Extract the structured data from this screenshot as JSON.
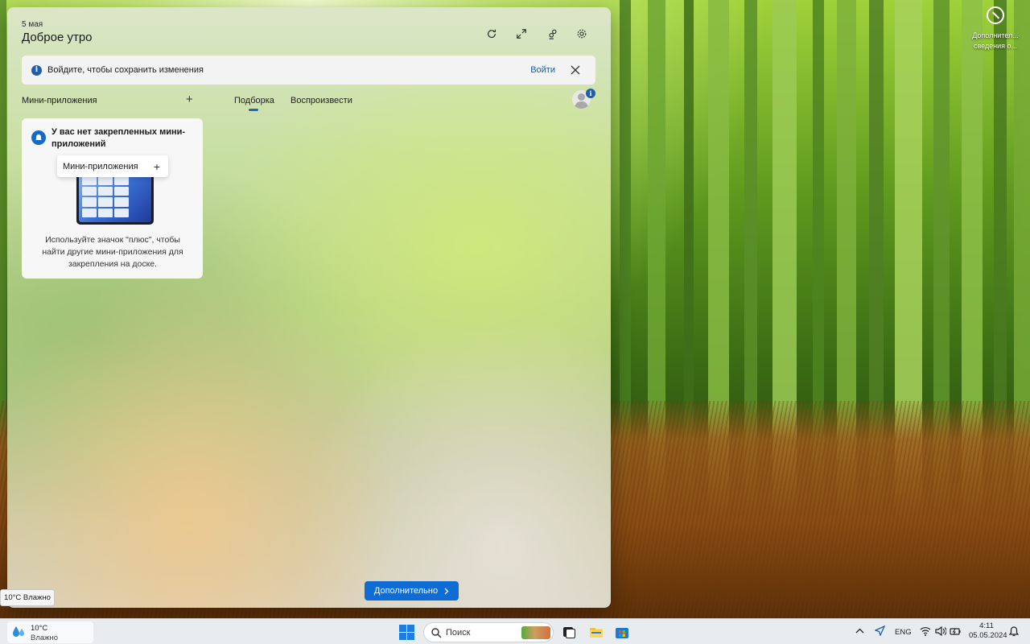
{
  "board": {
    "date": "5 мая",
    "greeting": "Доброе утро",
    "banner": {
      "message": "Войдите, чтобы сохранить изменения",
      "signin_link": "Войти"
    },
    "widgets_section_title": "Мини-приложения",
    "tabs": [
      {
        "label": "Подборка",
        "active": true
      },
      {
        "label": "Воспроизвести",
        "active": false
      }
    ],
    "empty_card": {
      "title": "У вас нет закрепленных мини-приложений",
      "pill_label": "Мини-приложения",
      "description": "Используйте значок \"плюс\", чтобы найти другие мини-приложения для закрепления на доске."
    },
    "more_button": "Дополнительно",
    "accent_color": "#0f6cd4"
  },
  "weather_tooltip": "10°C Влажно",
  "desktop_icon": {
    "line1": "Дополнител...",
    "line2": "сведения о..."
  },
  "taskbar": {
    "weather": {
      "temp": "10°C",
      "condition": "Влажно"
    },
    "search_placeholder": "Поиск",
    "tray": {
      "language": "ENG"
    },
    "clock": {
      "time": "4:11",
      "date": "05.05.2024"
    }
  }
}
